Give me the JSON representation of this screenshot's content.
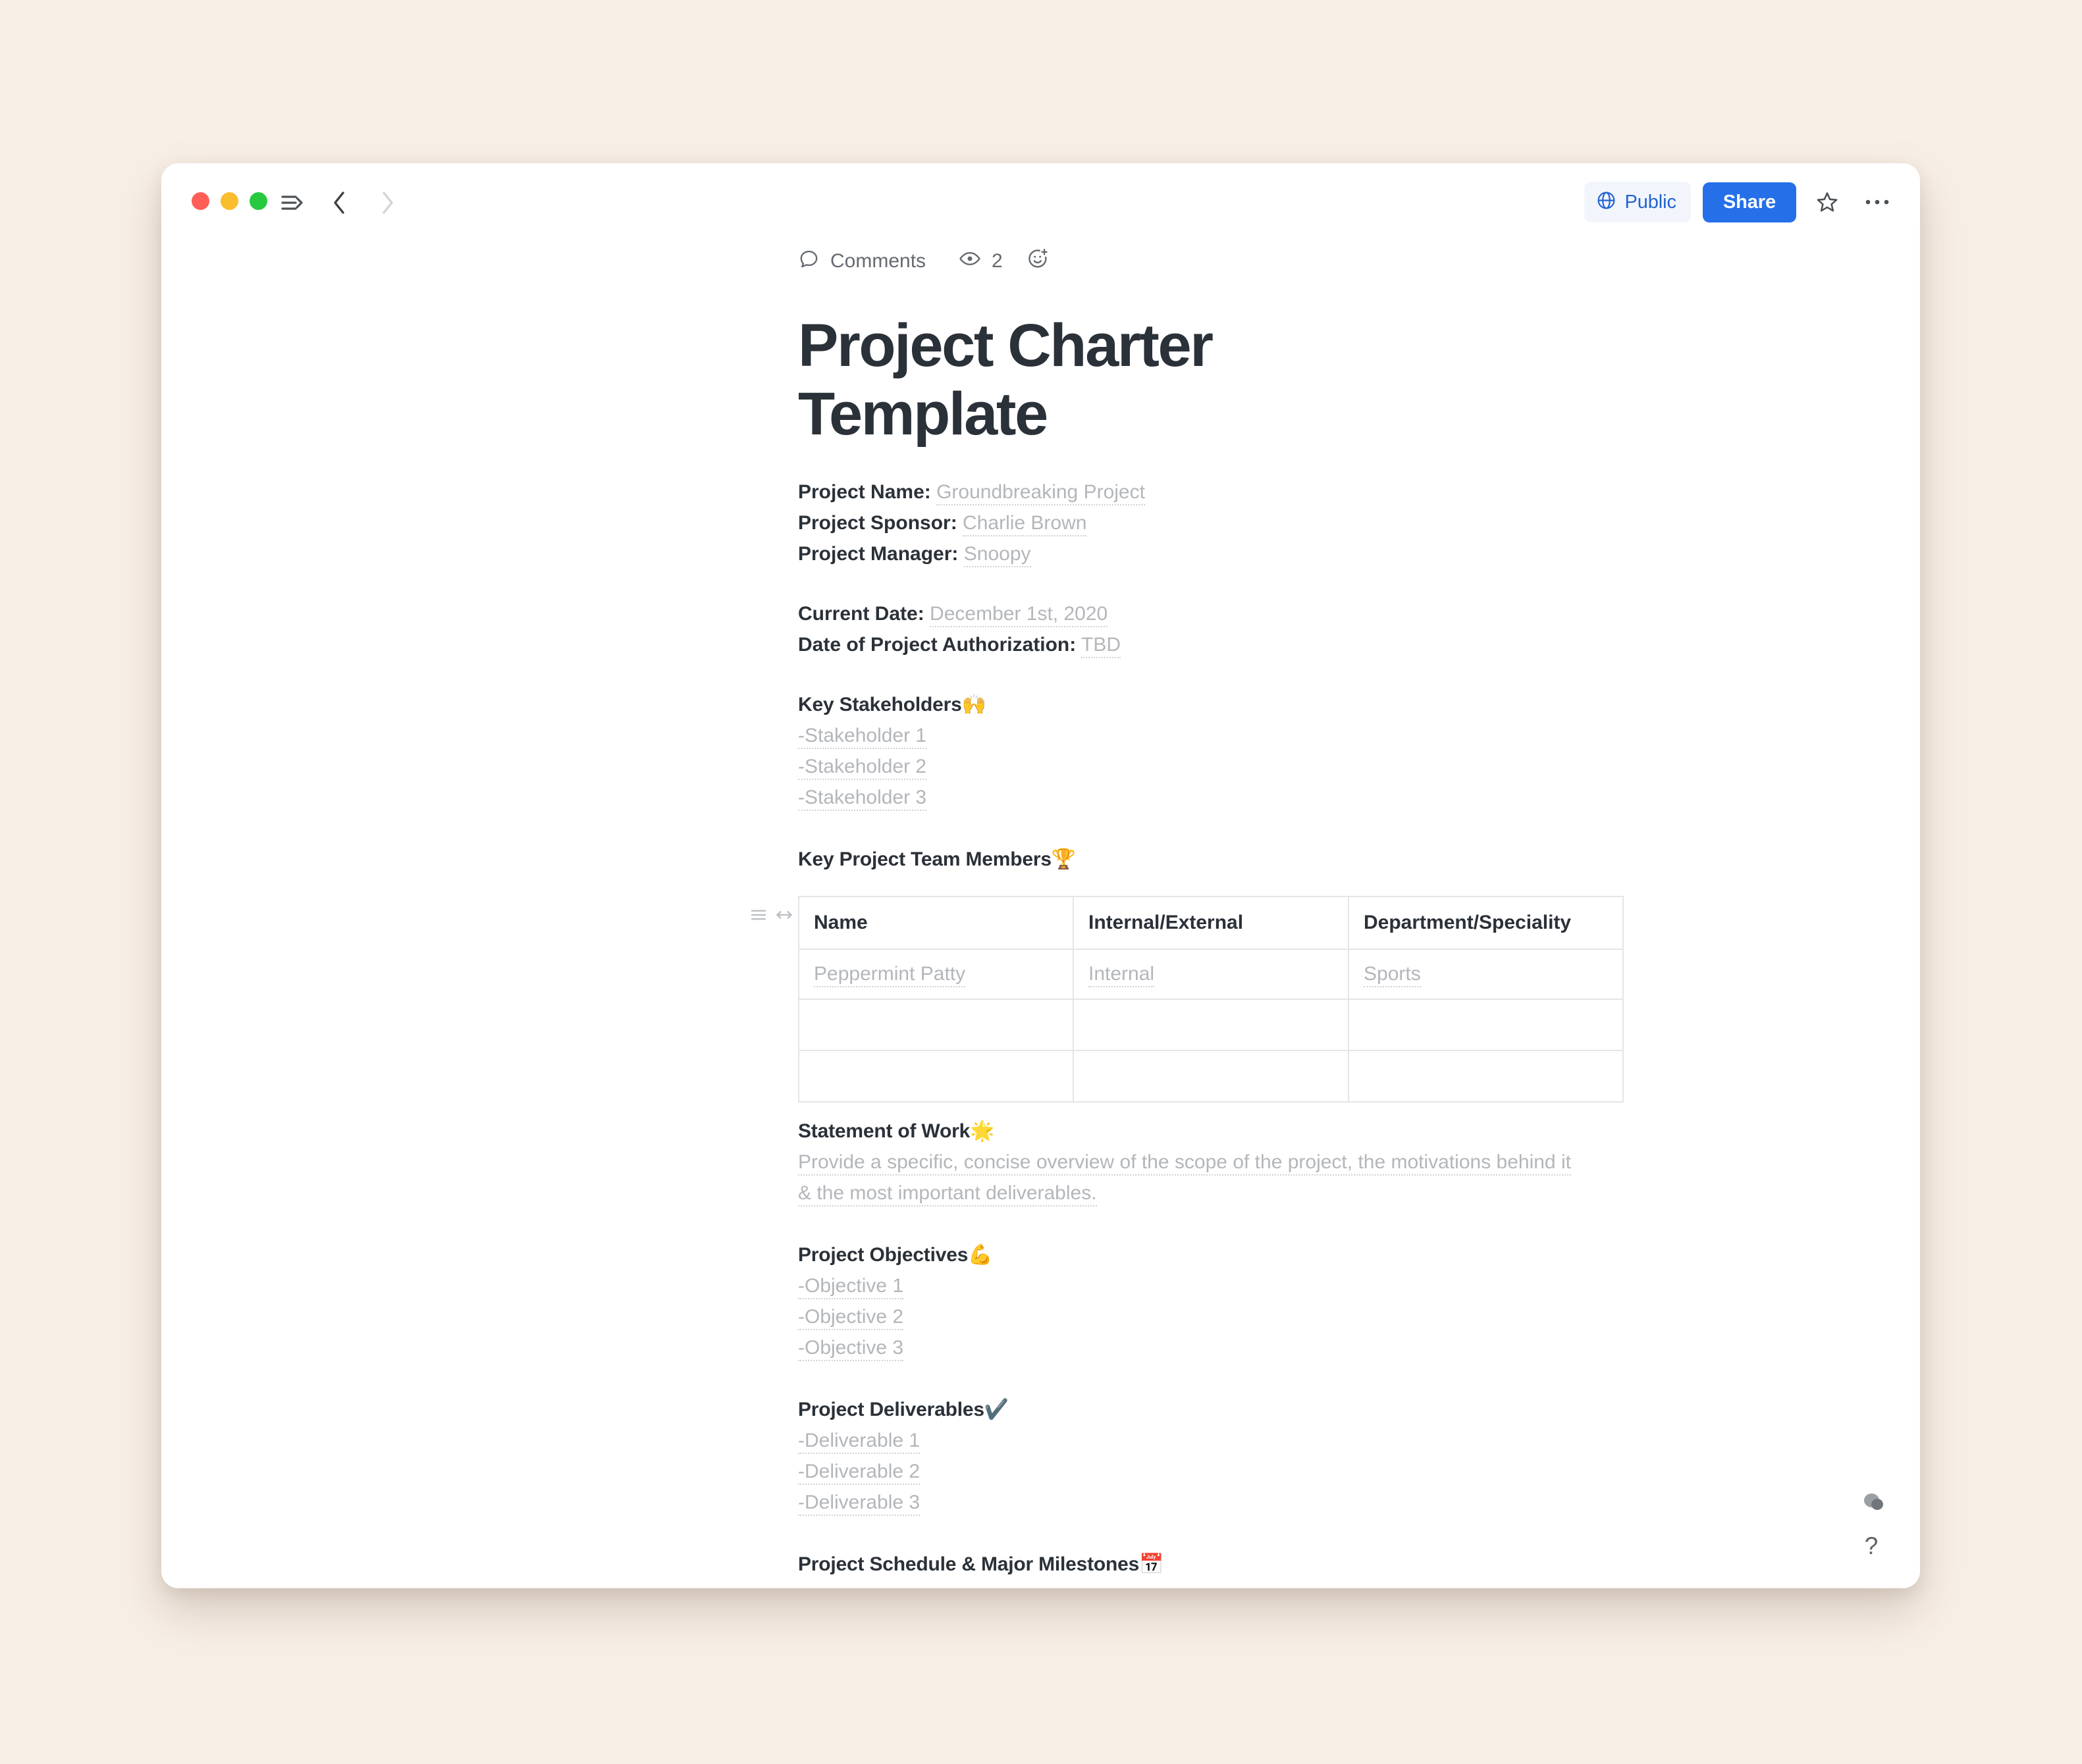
{
  "titlebar": {
    "traffic_lights": [
      {
        "name": "close",
        "color": "#ff5f57"
      },
      {
        "name": "minimize",
        "color": "#f9bd2e"
      },
      {
        "name": "maximize",
        "color": "#27c93f"
      }
    ],
    "sidebar_toggle_icon": "sidebar-toggle-icon",
    "back_icon": "chevron-left-icon",
    "forward_icon": "chevron-right-icon",
    "public_label": "Public",
    "public_icon": "globe-icon",
    "share_label": "Share",
    "favorite_icon": "star-icon",
    "more_icon": "ellipsis-icon",
    "accent_color": "#2570e8",
    "public_text_color": "#2264d1"
  },
  "meta": {
    "comments_label": "Comments",
    "comments_icon": "comment-bubble-icon",
    "views_icon": "eye-icon",
    "views_count": "2",
    "reaction_icon": "add-reaction-icon"
  },
  "document": {
    "title": "Project Charter Template",
    "fields": [
      {
        "label": "Project Name:",
        "value": "Groundbreaking Project"
      },
      {
        "label": "Project Sponsor:",
        "value": "Charlie Brown"
      },
      {
        "label": "Project Manager:",
        "value": "Snoopy"
      }
    ],
    "dates": [
      {
        "label": "Current Date:",
        "value": "December 1st, 2020"
      },
      {
        "label": "Date of Project Authorization:",
        "value": "TBD"
      }
    ],
    "stakeholders": {
      "heading": "Key Stakeholders",
      "emoji": "🙌",
      "items": [
        "-Stakeholder 1",
        "-Stakeholder 2",
        "-Stakeholder 3"
      ]
    },
    "team": {
      "heading": "Key Project Team Members",
      "emoji": "🏆",
      "columns": [
        "Name",
        "Internal/External",
        "Department/Speciality"
      ],
      "rows": [
        [
          "Peppermint Patty",
          "Internal",
          "Sports"
        ],
        [
          "",
          "",
          ""
        ],
        [
          "",
          "",
          ""
        ]
      ],
      "drag_icon": "drag-handle-icon",
      "resize_icon": "horizontal-resize-icon"
    },
    "statement_of_work": {
      "heading": "Statement of Work",
      "emoji": "🌟",
      "body": "Provide a specific, concise overview of the scope of the project, the motivations behind it & the most important deliverables."
    },
    "objectives": {
      "heading": "Project Objectives",
      "emoji": "💪",
      "items": [
        "-Objective 1",
        "-Objective 2",
        "-Objective 3"
      ]
    },
    "deliverables": {
      "heading": "Project Deliverables",
      "emoji": "✔️",
      "items": [
        "-Deliverable 1",
        "-Deliverable 2",
        "-Deliverable 3"
      ]
    },
    "schedule": {
      "heading": "Project Schedule & Major Milestones",
      "emoji": "📅"
    }
  },
  "floating": {
    "cursor_icon": "cursor-blob-icon",
    "help_label": "?"
  }
}
